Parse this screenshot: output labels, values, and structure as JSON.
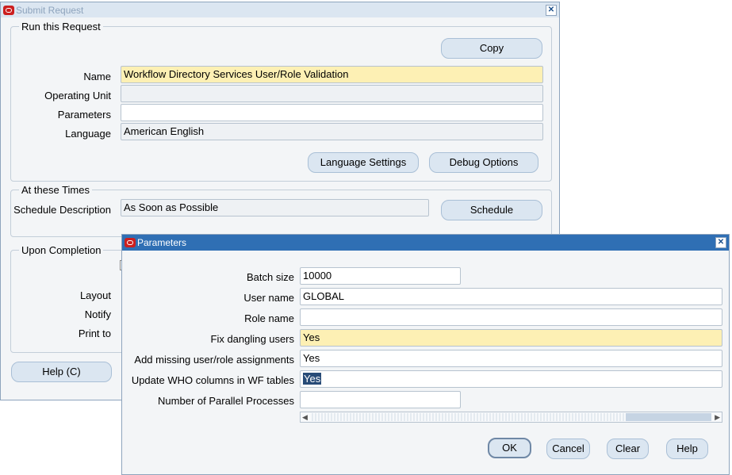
{
  "submit_window": {
    "title": "Submit Request",
    "run_group": {
      "title": "Run this Request",
      "copy_button": "Copy",
      "name_label": "Name",
      "name_value": "Workflow Directory Services User/Role Validation",
      "operating_unit_label": "Operating Unit",
      "operating_unit_value": "",
      "parameters_label": "Parameters",
      "parameters_value": "",
      "language_label": "Language",
      "language_value": "American English",
      "language_settings_button": "Language Settings",
      "debug_options_button": "Debug Options"
    },
    "times_group": {
      "title": "At these Times",
      "schedule_label": "Schedule Description",
      "schedule_value": "As Soon as Possible",
      "schedule_button": "Schedule"
    },
    "completion_group": {
      "title": "Upon Completion",
      "layout_label": "Layout",
      "notify_label": "Notify",
      "print_to_label": "Print to"
    },
    "help_button": "Help (C)"
  },
  "parameters_window": {
    "title": "Parameters",
    "fields": [
      {
        "label": "Batch size",
        "value": "10000"
      },
      {
        "label": "User name",
        "value": "GLOBAL"
      },
      {
        "label": "Role name",
        "value": ""
      },
      {
        "label": "Fix dangling users",
        "value": "Yes"
      },
      {
        "label": "Add missing user/role assignments",
        "value": "Yes"
      },
      {
        "label": "Update WHO columns in WF tables",
        "value": "Yes"
      },
      {
        "label": "Number of Parallel Processes",
        "value": ""
      }
    ],
    "buttons": {
      "ok": "OK",
      "cancel": "Cancel",
      "clear": "Clear",
      "help": "Help"
    }
  },
  "colors": {
    "submit_titlebar": "#dbe6f1",
    "parameters_titlebar": "#2f6fb4",
    "required_field": "#fdf0b4",
    "selection": "#284b77"
  }
}
